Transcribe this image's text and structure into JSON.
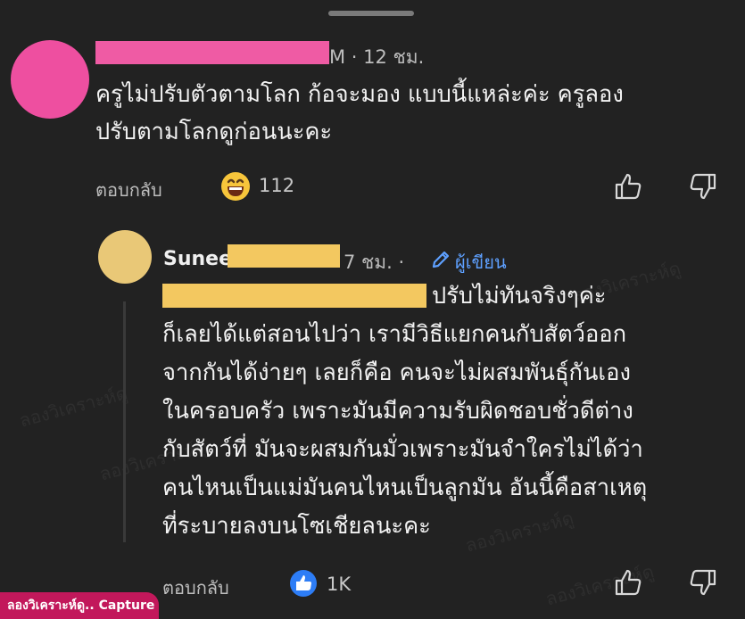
{
  "comments": [
    {
      "meta_suffix": "M · 12 ชม.",
      "lines": [
        "ครูไม่ปรับตัวตามโลก ก้อจะมอง แบบนี้แหล่ะค่ะ ครูลอง",
        "ปรับตามโลกดูก่อนนะคะ"
      ],
      "reply_label": "ตอบกลับ",
      "reaction_count": "112",
      "reaction_icon": "laughing-emoji-icon",
      "avatar_color": "#ee4fa0",
      "redaction_color": "#ef5ba4"
    },
    {
      "name_visible": "Sunee",
      "meta_suffix": "7 ชม. ·",
      "author_badge": "ผู้เขียน",
      "lines": [
        "ปรับไม่ทันจริงๆค่ะ",
        "ก็เลยได้แต่สอนไปว่า เรามีวิธีแยกคนกับสัตว์ออก",
        "จากกันได้ง่ายๆ เลยก็คือ คนจะไม่ผสมพันธุ์กันเอง",
        "ในครอบครัว เพราะมันมีความรับผิดชอบชั่วดีต่าง",
        "กับสัตว์ที่ มันจะผสมกันมั่วเพราะมันจำใครไม่ได้ว่า",
        "คนไหนเป็นแม่มันคนไหนเป็นลูกมัน อันนี้คือสาเหตุ",
        "ที่ระบายลงบนโซเชียลนะคะ"
      ],
      "reply_label": "ตอบกลับ",
      "reaction_count": "1K",
      "reaction_icon": "like-thumb-icon",
      "avatar_color": "#e9c877",
      "redaction_color": "#f3c860"
    }
  ],
  "watermark_text": "ลองวิเคราะห์ดู",
  "capture_badge": "ลองวิเคราะห์ดู.. Capture",
  "colors": {
    "background": "#222222",
    "accent_blue": "#5ea0ff",
    "like_blue": "#2d7df6"
  }
}
